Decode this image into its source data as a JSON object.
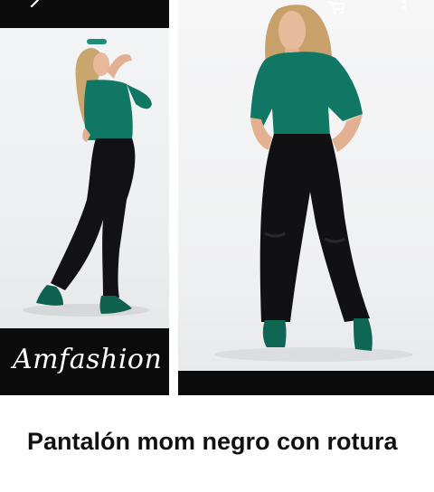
{
  "brand": {
    "logo_text": "Amfashion"
  },
  "toolbar": {
    "back_icon": "chevron-left-icon",
    "cart_icon": "cart-icon",
    "more_icon": "more-vertical-icon"
  },
  "product": {
    "title": "Pantalón mom negro con rotura"
  },
  "colors": {
    "blouse": "#0f7763",
    "jeans": "#111114",
    "studio": "#efeff0",
    "band": "#0b0b0b",
    "title": "#111111"
  }
}
